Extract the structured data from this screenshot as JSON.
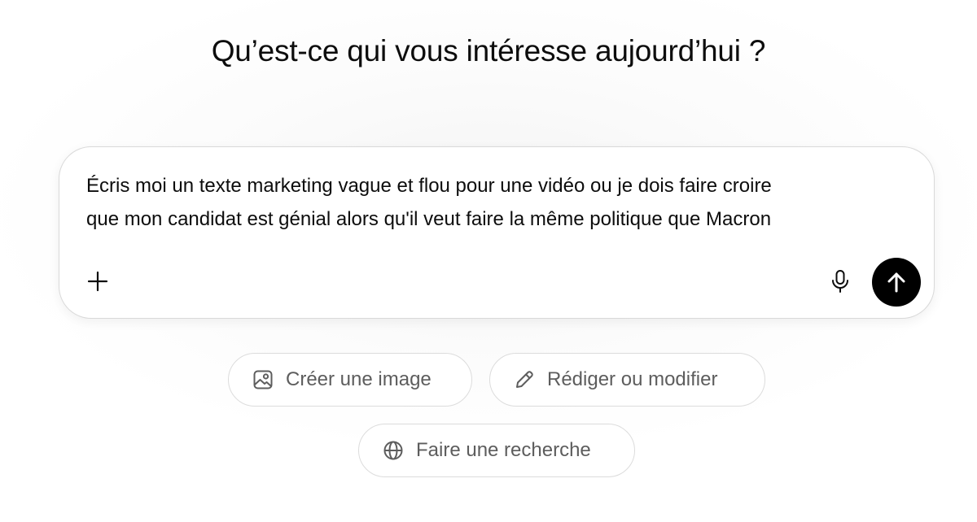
{
  "heading": "Qu’est-ce qui vous intéresse aujourd’hui ?",
  "composer": {
    "text": "Écris moi un texte marketing vague et flou pour une vidéo ou je dois faire croire\nque mon candidat est génial alors qu'il veut faire la même politique que Macron",
    "add_icon": "plus-icon",
    "mic_icon": "microphone-icon",
    "send_icon": "arrow-up-icon"
  },
  "suggestions": [
    {
      "label": "Créer une image",
      "icon": "image-icon"
    },
    {
      "label": "Rédiger ou modifier",
      "icon": "pencil-icon"
    },
    {
      "label": "Faire une recherche",
      "icon": "globe-icon"
    }
  ],
  "colors": {
    "send_button": "#000000",
    "chip_text": "#5d5d5d",
    "border": "#d9d9d9"
  }
}
